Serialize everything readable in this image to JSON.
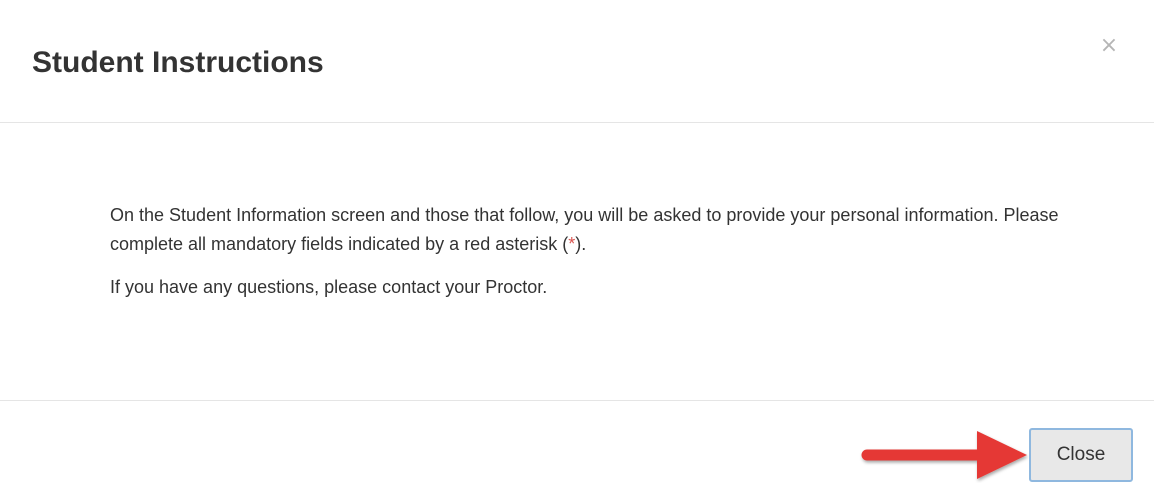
{
  "dialog": {
    "title": "Student Instructions",
    "close_x_label": "×",
    "body": {
      "line1_before": "On the Student Information screen and those that follow, you will be asked to provide your personal information. Please complete all mandatory fields indicated by a red asterisk (",
      "asterisk": "*",
      "line1_after": ").",
      "paragraph2": "If you have any questions, please contact your Proctor."
    },
    "footer": {
      "close_button_label": "Close"
    }
  },
  "colors": {
    "asterisk": "#d9534f",
    "arrow": "#e53935",
    "button_border": "#8fb8df"
  },
  "icons": {
    "close_x": "close-icon",
    "annotation_arrow": "arrow-right-icon"
  }
}
